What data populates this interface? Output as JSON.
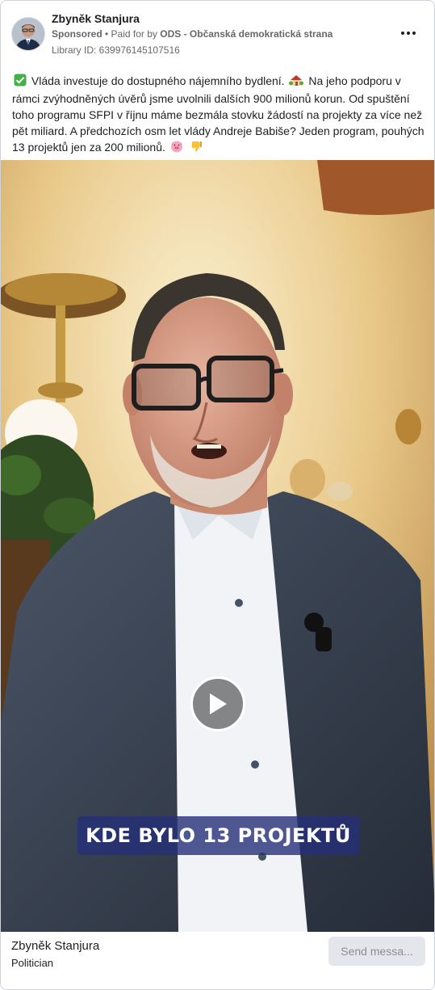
{
  "post": {
    "page_name": "Zbyněk Stanjura",
    "sponsored_label": "Sponsored",
    "paid_prefix": " • Paid for by ",
    "payer": "ODS - Občanská demokratická strana",
    "library_id": "Library ID: 639976145107516",
    "text_parts": [
      "Vláda investuje do dostupného nájemního bydlení.",
      "Na jeho podporu v rámci zvýhodněných úvěrů jsme uvolnili dalších 900 milionů korun. Od spuštění toho programu SFPI v říjnu máme bezmála stovku žádostí na projekty za více než pět miliard. A předchozích osm let vlády Andreje Babiše? Jeden program, pouhých 13 projektů jen za 200 milionů."
    ],
    "emojis": [
      "check-mark-button",
      "house-with-garden",
      "pig-face",
      "thumbs-down"
    ]
  },
  "video": {
    "caption": "KDE BYLO 13 PROJEKTŮ"
  },
  "footer": {
    "name": "Zbyněk Stanjura",
    "category": "Politician",
    "cta_label": "Send messa..."
  },
  "colors": {
    "text": "#1c1e21",
    "secondary": "#65676b",
    "caption_bg": "#263078",
    "button_bg": "#e4e6eb"
  }
}
